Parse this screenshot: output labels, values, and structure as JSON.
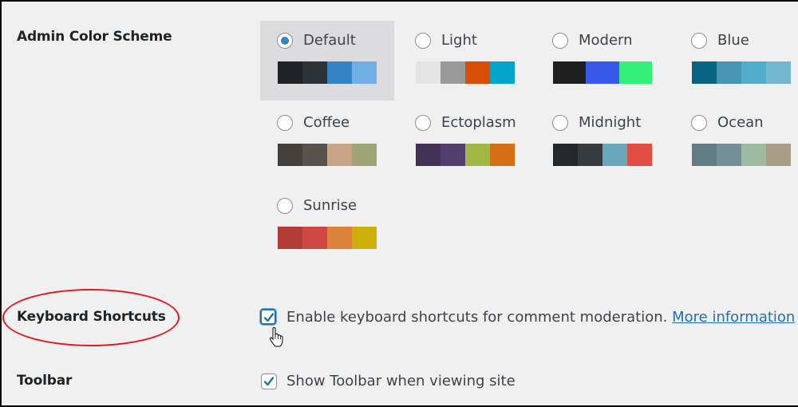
{
  "admin_color_scheme": {
    "label": "Admin Color Scheme",
    "selected": "Default",
    "schemes": [
      {
        "name": "Default",
        "checked": true,
        "colors": [
          "#1d2327",
          "#2c3338",
          "#3582c4",
          "#72aee6"
        ]
      },
      {
        "name": "Light",
        "checked": false,
        "colors": [
          "#e5e5e5",
          "#999999",
          "#d64e07",
          "#04a4cc"
        ]
      },
      {
        "name": "Modern",
        "checked": false,
        "colors": [
          "#1e1e1e",
          "#3858e9",
          "#33f078"
        ]
      },
      {
        "name": "Blue",
        "checked": false,
        "colors": [
          "#096484",
          "#4796b3",
          "#52accc",
          "#74b6ce"
        ]
      },
      {
        "name": "Coffee",
        "checked": false,
        "colors": [
          "#46403c",
          "#59524c",
          "#c7a589",
          "#9ea476"
        ]
      },
      {
        "name": "Ectoplasm",
        "checked": false,
        "colors": [
          "#413256",
          "#523f6d",
          "#a3b745",
          "#d46f15"
        ]
      },
      {
        "name": "Midnight",
        "checked": false,
        "colors": [
          "#25282b",
          "#363b3f",
          "#69a8bb",
          "#e14d43"
        ]
      },
      {
        "name": "Ocean",
        "checked": false,
        "colors": [
          "#627c83",
          "#738e96",
          "#9ebaa0",
          "#aa9d88"
        ]
      },
      {
        "name": "Sunrise",
        "checked": false,
        "colors": [
          "#b43c38",
          "#cf4944",
          "#dd823b",
          "#ccaf0b"
        ]
      }
    ]
  },
  "keyboard_shortcuts": {
    "label": "Keyboard Shortcuts",
    "checked": true,
    "text": "Enable keyboard shortcuts for comment moderation.",
    "link": "More information"
  },
  "toolbar": {
    "label": "Toolbar",
    "checked": true,
    "text": "Show Toolbar when viewing site"
  },
  "annotation": {
    "color": "#e0181b"
  }
}
